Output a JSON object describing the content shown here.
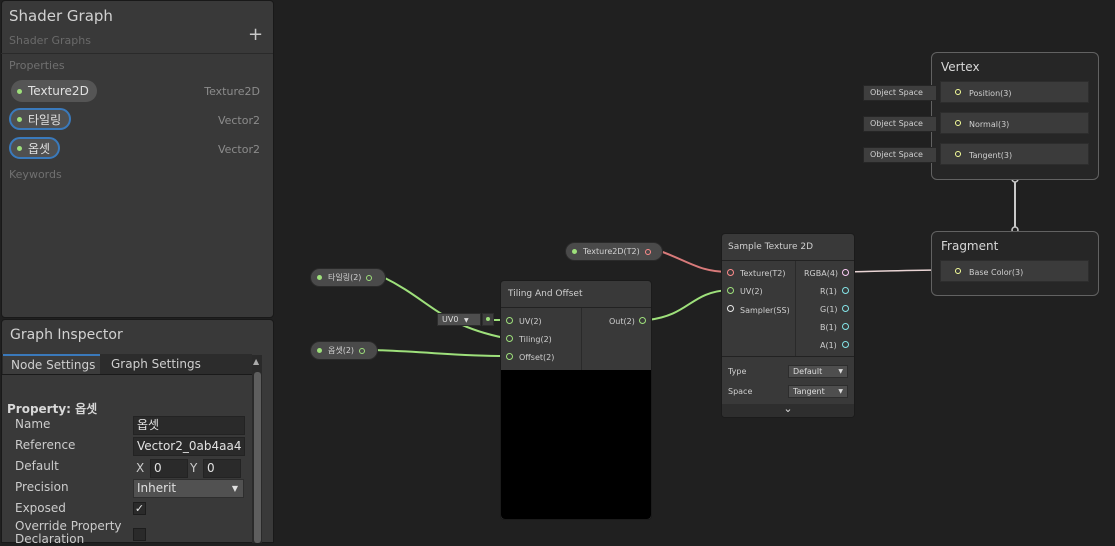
{
  "blackboard": {
    "title": "Shader Graph",
    "subtitle": "Shader Graphs",
    "add_symbol": "+",
    "properties_section": "Properties",
    "keywords_section": "Keywords",
    "properties": [
      {
        "name": "Texture2D",
        "type": "Texture2D"
      },
      {
        "name": "타일링",
        "type": "Vector2"
      },
      {
        "name": "옵셋",
        "type": "Vector2"
      }
    ]
  },
  "inspector": {
    "title": "Graph Inspector",
    "tabs": [
      "Node Settings",
      "Graph Settings"
    ],
    "property_heading": "Property: 옵셋",
    "name_label": "Name",
    "name_value": "옵셋",
    "reference_label": "Reference",
    "reference_value": "Vector2_0ab4aa4",
    "default_label": "Default",
    "x_label": "X",
    "x_value": "0",
    "y_label": "Y",
    "y_value": "0",
    "precision_label": "Precision",
    "precision_value": "Inherit",
    "exposed_label": "Exposed",
    "exposed_checked": true,
    "override_label": "Override Property Declaration",
    "check_glyph": "✓"
  },
  "graph": {
    "prop_tiling": "타일링(2)",
    "prop_offset": "옵셋(2)",
    "prop_texture": "Texture2D(T2)",
    "uv_dropdown": "UV0",
    "tiling_node": {
      "title": "Tiling And Offset",
      "inputs": [
        "UV(2)",
        "Tiling(2)",
        "Offset(2)"
      ],
      "output": "Out(2)"
    },
    "sample_node": {
      "title": "Sample Texture 2D",
      "inputs": [
        "Texture(T2)",
        "UV(2)",
        "Sampler(SS)"
      ],
      "outputs": [
        "RGBA(4)",
        "R(1)",
        "G(1)",
        "B(1)",
        "A(1)"
      ],
      "type_label": "Type",
      "type_value": "Default",
      "space_label": "Space",
      "space_value": "Tangent",
      "expand_glyph": "⌄"
    },
    "vertex": {
      "title": "Vertex",
      "ctx": "Object Space",
      "slots": [
        "Position(3)",
        "Normal(3)",
        "Tangent(3)"
      ]
    },
    "fragment": {
      "title": "Fragment",
      "slots": [
        "Base Color(3)"
      ]
    }
  },
  "colors": {
    "vector2": "#9ee07b",
    "texture": "#ff8b8b",
    "vector4": "#fbcbf4",
    "vector3": "#f6ff9a",
    "float": "#84e4e7",
    "selection": "#3a7abc"
  },
  "icons": [
    "plus-icon",
    "dropdown-arrow-icon",
    "checkmark-icon",
    "chevron-down-icon",
    "scroll-up-icon"
  ]
}
